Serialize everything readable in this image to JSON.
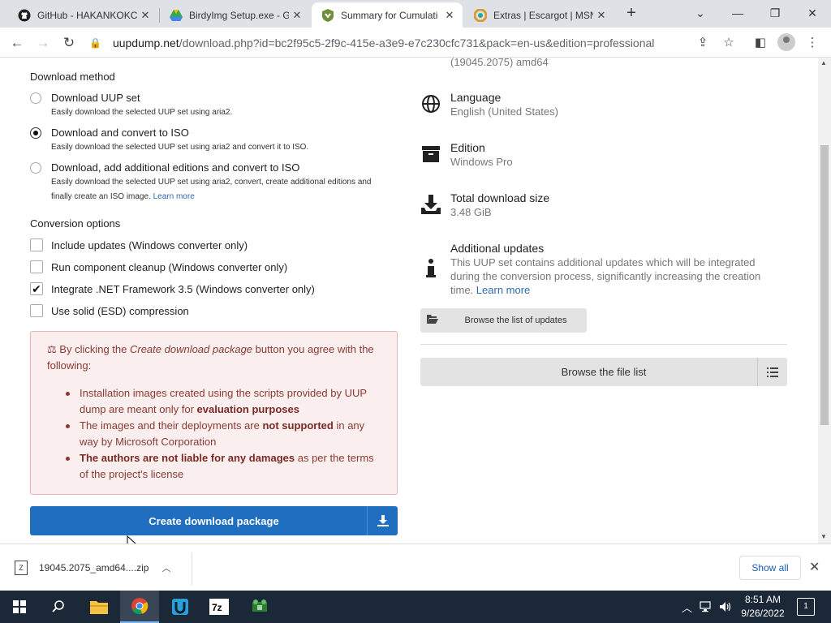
{
  "browser": {
    "tabs": [
      {
        "label": "GitHub - HAKANKOKCU",
        "icon": "github-icon"
      },
      {
        "label": "BirdyImg Setup.exe - G",
        "icon": "drive-icon"
      },
      {
        "label": "Summary for Cumulati",
        "icon": "uupdump-icon",
        "active": true
      },
      {
        "label": "Extras | Escargot | MSN",
        "icon": "escargot-icon"
      }
    ],
    "url_host": "uupdump.net",
    "url_path": "/download.php?id=bc2f95c5-2f9c-415e-a3e9-e7c230cfc731&pack=en-us&edition=professional"
  },
  "download_method": {
    "title": "Download method",
    "options": [
      {
        "label": "Download UUP set",
        "desc": "Easily download the selected UUP set using aria2.",
        "selected": false
      },
      {
        "label": "Download and convert to ISO",
        "desc": "Easily download the selected UUP set using aria2 and convert it to ISO.",
        "selected": true
      },
      {
        "label": "Download, add additional editions and convert to ISO",
        "desc": "Easily download the selected UUP set using aria2, convert, create additional editions and finally create an ISO image.",
        "link": "Learn more",
        "selected": false
      }
    ]
  },
  "conversion": {
    "title": "Conversion options",
    "options": [
      {
        "label": "Include updates (Windows converter only)",
        "checked": false
      },
      {
        "label": "Run component cleanup (Windows converter only)",
        "checked": false
      },
      {
        "label": "Integrate .NET Framework 3.5 (Windows converter only)",
        "checked": true
      },
      {
        "label": "Use solid (ESD) compression",
        "checked": false
      }
    ]
  },
  "warning": {
    "head_pre": "By clicking the ",
    "head_em": "Create download package",
    "head_post": " button you agree with the following:",
    "items": [
      {
        "pre": "Installation images created using the scripts provided by UUP dump are meant only for ",
        "bold": "evaluation purposes",
        "post": ""
      },
      {
        "pre": "The images and their deployments are ",
        "bold": "not supported",
        "post": " in any way by Microsoft Corporation"
      },
      {
        "pre": "",
        "bold": "The authors are not liable for any damages",
        "post": " as per the terms of the project's license"
      }
    ]
  },
  "create_button": "Create download package",
  "info": {
    "build_tail": "(19045.2075) amd64",
    "language_title": "Language",
    "language_value": "English (United States)",
    "edition_title": "Edition",
    "edition_value": "Windows Pro",
    "size_title": "Total download size",
    "size_value": "3.48 GiB",
    "updates_title": "Additional updates",
    "updates_value": "This UUP set contains additional updates which will be integrated during the conversion process, significantly increasing the creation time.",
    "updates_link": "Learn more",
    "browse_updates": "Browse the list of updates",
    "browse_files": "Browse the file list"
  },
  "download_bar": {
    "file": "19045.2075_amd64....zip",
    "show_all": "Show all"
  },
  "taskbar": {
    "time": "8:51 AM",
    "date": "9/26/2022",
    "notif_count": "1"
  }
}
